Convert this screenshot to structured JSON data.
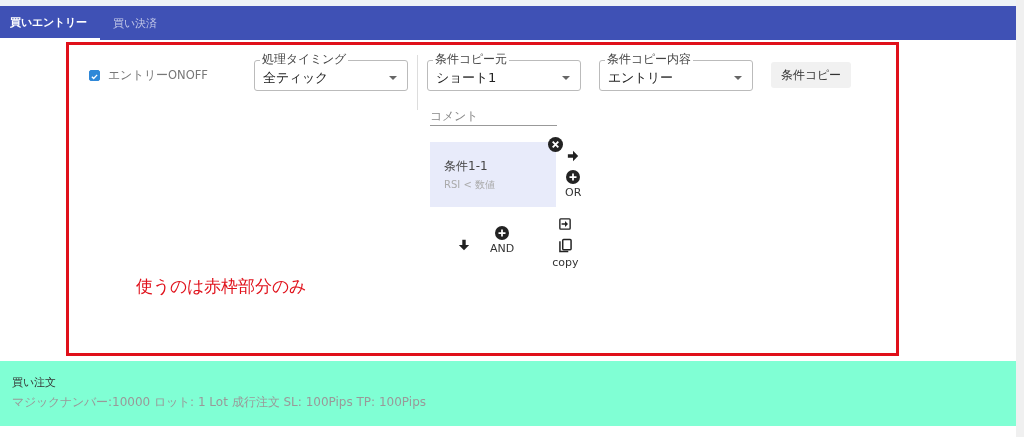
{
  "tabs": [
    {
      "label": "買いエントリー",
      "selected": true
    },
    {
      "label": "買い決済",
      "selected": false
    }
  ],
  "entry_toggle": {
    "label": "エントリーONOFF",
    "checked": true
  },
  "selects": [
    {
      "label": "処理タイミング",
      "value": "全ティック"
    },
    {
      "label": "条件コピー元",
      "value": "ショート1"
    },
    {
      "label": "条件コピー内容",
      "value": "エントリー"
    }
  ],
  "copy_button": "条件コピー",
  "comment": {
    "placeholder": "コメント"
  },
  "condition": {
    "title": "条件1-1",
    "detail": "RSI < 数値"
  },
  "or_label": "OR",
  "and_label": "AND",
  "copy_label": "copy",
  "annotation": "使うのは赤枠部分のみ",
  "order": {
    "title": "買い注文",
    "detail": "マジックナンバー:10000 ロット: 1 Lot 成行注文 SL: 100Pips TP: 100Pips"
  }
}
